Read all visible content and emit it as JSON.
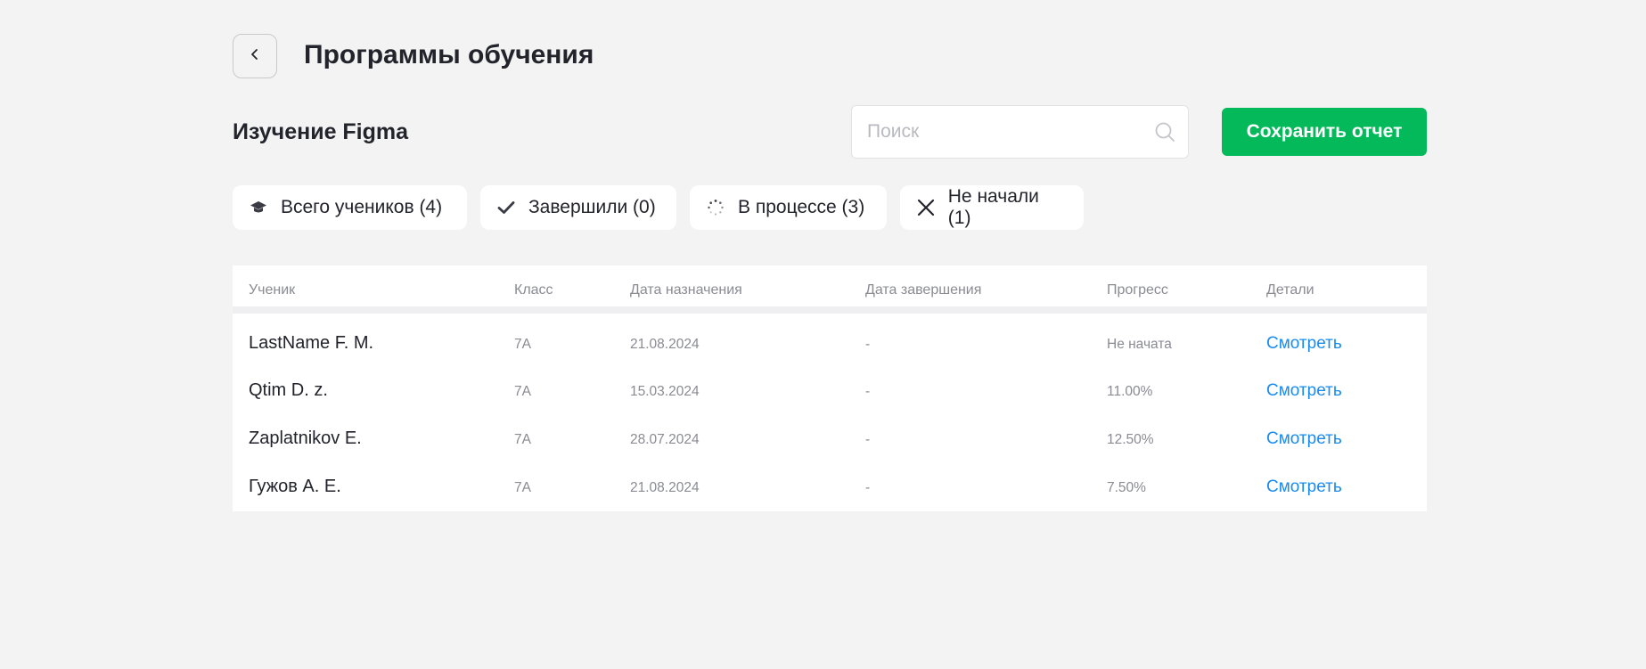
{
  "header": {
    "title": "Программы обучения",
    "back_icon": "chevron-left-icon"
  },
  "course": {
    "title": "Изучение Figma"
  },
  "search": {
    "placeholder": "Поиск",
    "value": "",
    "icon": "search-icon"
  },
  "actions": {
    "save_label": "Сохранить отчет",
    "save_color": "#03b95a"
  },
  "filters": [
    {
      "label": "Всего учеников (4)",
      "icon": "graduation-cap-icon"
    },
    {
      "label": "Завершили (0)",
      "icon": "check-icon"
    },
    {
      "label": "В процессе (3)",
      "icon": "spinner-icon"
    },
    {
      "label": "Не начали (1)",
      "icon": "close-icon"
    }
  ],
  "table": {
    "columns": [
      "Ученик",
      "Класс",
      "Дата назначения",
      "Дата завершения",
      "Прогресс",
      "Детали"
    ],
    "rows": [
      {
        "student": "LastName F. M.",
        "class": "7A",
        "assigned": "21.08.2024",
        "completed": "-",
        "progress": "Не начата",
        "details": "Смотреть"
      },
      {
        "student": "Qtim D. z.",
        "class": "7A",
        "assigned": "15.03.2024",
        "completed": "-",
        "progress": "11.00%",
        "details": "Смотреть"
      },
      {
        "student": "Zaplatnikov E.",
        "class": "7A",
        "assigned": "28.07.2024",
        "completed": "-",
        "progress": "12.50%",
        "details": "Смотреть"
      },
      {
        "student": "Гужов А. Е.",
        "class": "7A",
        "assigned": "21.08.2024",
        "completed": "-",
        "progress": "7.50%",
        "details": "Смотреть"
      }
    ]
  },
  "colors": {
    "background": "#f3f3f3",
    "accent_green": "#03b95a",
    "link_blue": "#1a8cf0",
    "text_primary": "#22232b",
    "text_muted": "#8a8b93"
  }
}
